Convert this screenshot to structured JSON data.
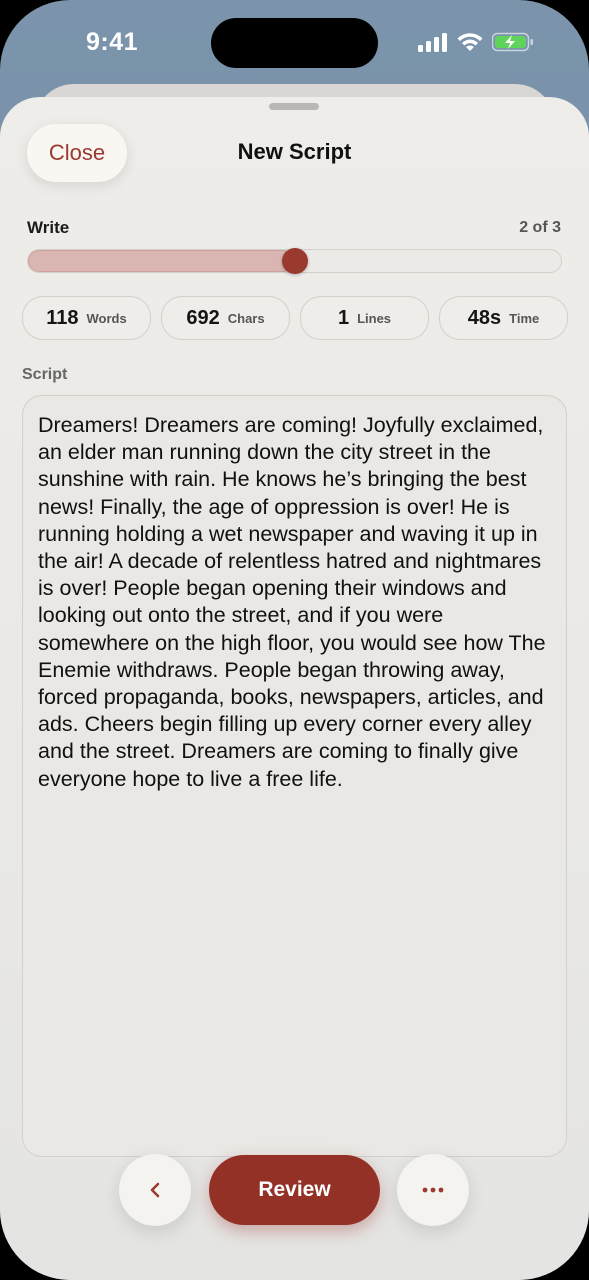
{
  "status_bar": {
    "time": "9:41"
  },
  "header": {
    "close_label": "Close",
    "title": "New Script"
  },
  "progress": {
    "label": "Write",
    "count": "2 of 3",
    "fraction": 0.5
  },
  "stats": [
    {
      "value": "118",
      "label": "Words"
    },
    {
      "value": "692",
      "label": "Chars"
    },
    {
      "value": "1",
      "label": "Lines"
    },
    {
      "value": "48s",
      "label": "Time"
    }
  ],
  "script": {
    "label": "Script",
    "text": "Dreamers! Dreamers are coming! Joyfully exclaimed, an elder man running down the city street in the sunshine with rain. He knows he’s bringing the best news! Finally, the age of oppression is over! He is running holding a wet newspaper and waving it up in the air! A decade of relentless hatred and nightmares is over! People began opening their windows and looking out onto the street, and if you were somewhere on the high floor, you would see how The Enemie withdraws. People began throwing away, forced propaganda, books, newspapers, articles, and ads. Cheers begin filling up every corner every alley and the street. Dreamers are coming to finally give everyone hope to live a free life."
  },
  "footer": {
    "review_label": "Review"
  },
  "icons": {
    "back": "chevron-left-icon",
    "more": "ellipsis-icon",
    "signal": "cellular-signal-icon",
    "wifi": "wifi-icon",
    "battery": "battery-charging-icon"
  },
  "colors": {
    "accent": "#943127",
    "progress_fill": "#d9b6b2",
    "battery": "#5fd35b"
  }
}
